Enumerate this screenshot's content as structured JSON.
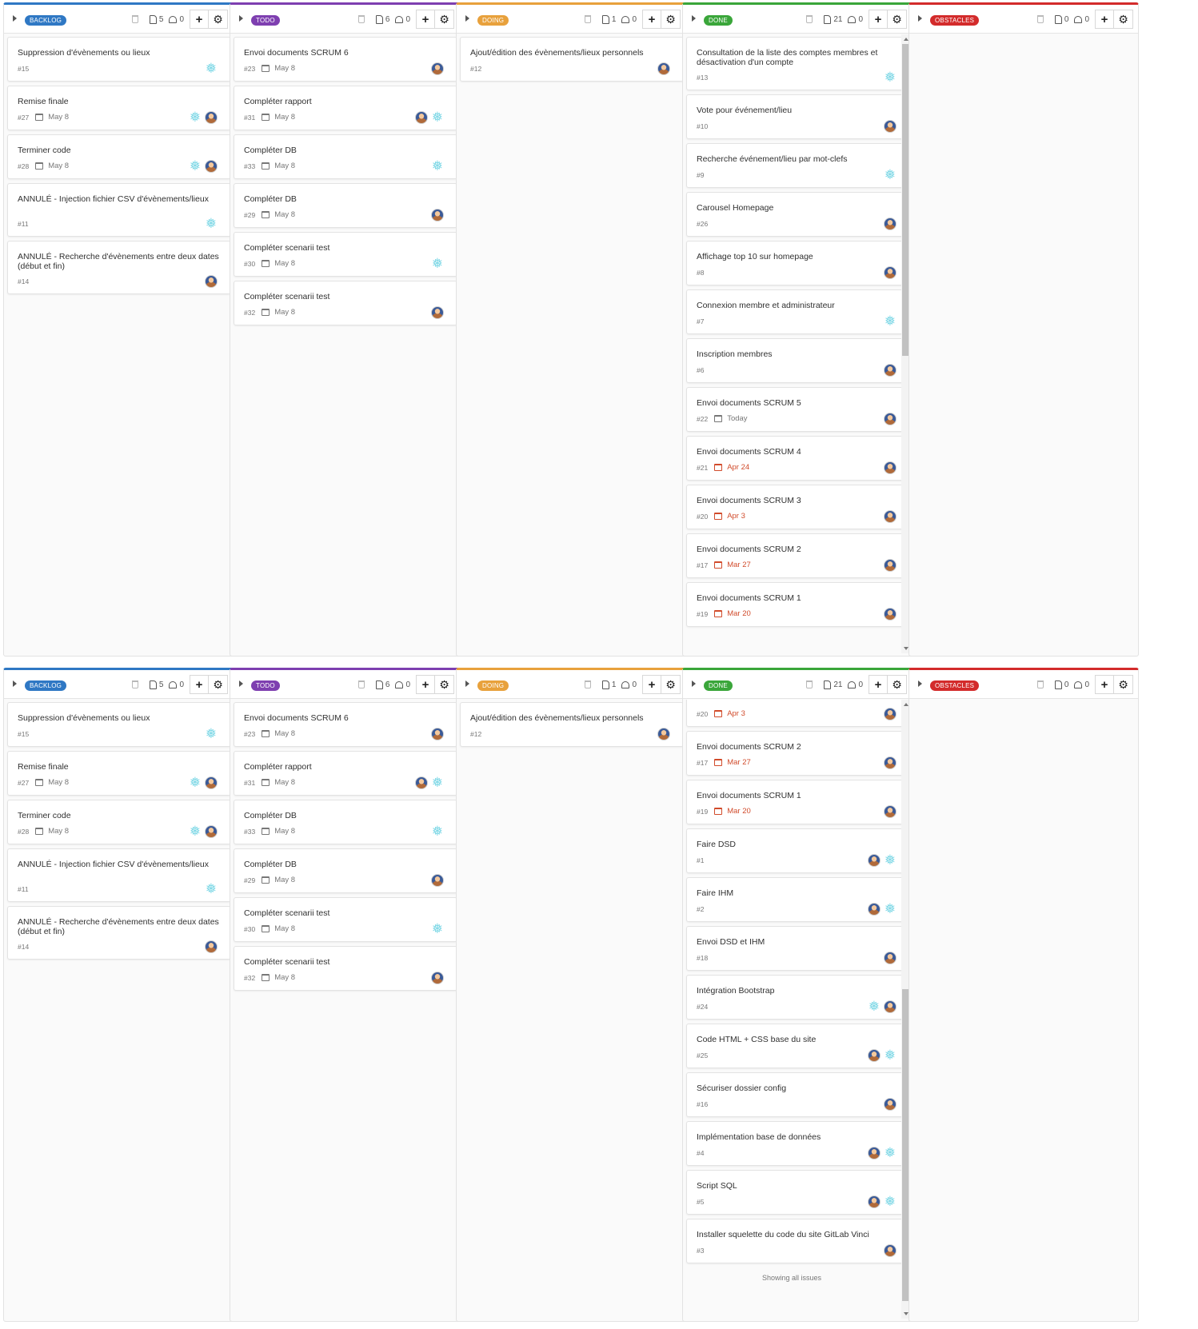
{
  "colors": {
    "backlog": "#2f78c4",
    "todo": "#7e3fb0",
    "doing": "#e8a13c",
    "done": "#3aa63a",
    "obstacles": "#d32b2b",
    "overdue": "#d14b2b"
  },
  "icons": {
    "trash": "trash-icon",
    "issues": "issue-icon",
    "weight": "weight-icon",
    "add": "plus-icon",
    "settings": "gear-icon",
    "calendar": "calendar-icon",
    "collapse": "caret-right-icon",
    "identicon": "snowflake-avatar-icon"
  },
  "columns": {
    "backlog": {
      "label": "BACKLOG",
      "issues": "5",
      "weight": "0",
      "cards": [
        {
          "title": "Suppression d'évènements ou lieux",
          "id": "#15",
          "due": "",
          "assignees": [
            "snow"
          ]
        },
        {
          "title": "Remise finale",
          "id": "#27",
          "due": "May 8",
          "assignees": [
            "snow",
            "avatar"
          ]
        },
        {
          "title": "Terminer code",
          "id": "#28",
          "due": "May 8",
          "assignees": [
            "snow",
            "avatar"
          ]
        },
        {
          "title": "ANNULÉ - Injection fichier CSV d'évènements/lieux",
          "id": "#11",
          "due": "",
          "assignees": [
            "snow"
          ]
        },
        {
          "title": "ANNULÉ - Recherche d'évènements entre deux dates (début et fin)",
          "id": "#14",
          "due": "",
          "assignees": [
            "avatar"
          ]
        }
      ]
    },
    "todo": {
      "label": "TODO",
      "issues": "6",
      "weight": "0",
      "cards": [
        {
          "title": "Envoi documents SCRUM 6",
          "id": "#23",
          "due": "May 8",
          "assignees": [
            "avatar"
          ]
        },
        {
          "title": "Compléter rapport",
          "id": "#31",
          "due": "May 8",
          "assignees": [
            "avatar",
            "snow"
          ]
        },
        {
          "title": "Compléter DB",
          "id": "#33",
          "due": "May 8",
          "assignees": [
            "snow"
          ]
        },
        {
          "title": "Compléter DB",
          "id": "#29",
          "due": "May 8",
          "assignees": [
            "avatar"
          ]
        },
        {
          "title": "Compléter scenarii test",
          "id": "#30",
          "due": "May 8",
          "assignees": [
            "snow"
          ]
        },
        {
          "title": "Compléter scenarii test",
          "id": "#32",
          "due": "May 8",
          "assignees": [
            "avatar"
          ]
        }
      ]
    },
    "doing": {
      "label": "DOING",
      "issues": "1",
      "weight": "0",
      "cards": [
        {
          "title": "Ajout/édition des évènements/lieux personnels",
          "id": "#12",
          "due": "",
          "assignees": [
            "avatar"
          ]
        }
      ]
    },
    "done": {
      "label": "DONE",
      "issues": "21",
      "weight": "0",
      "cards": [
        {
          "title": "Consultation de la liste des comptes membres et désactivation d'un compte",
          "id": "#13",
          "due": "",
          "assignees": [
            "snow"
          ]
        },
        {
          "title": "Vote pour événement/lieu",
          "id": "#10",
          "due": "",
          "assignees": [
            "avatar"
          ]
        },
        {
          "title": "Recherche événement/lieu par mot-clefs",
          "id": "#9",
          "due": "",
          "assignees": [
            "snow"
          ]
        },
        {
          "title": "Carousel Homepage",
          "id": "#26",
          "due": "",
          "assignees": [
            "avatar"
          ]
        },
        {
          "title": "Affichage top 10 sur homepage",
          "id": "#8",
          "due": "",
          "assignees": [
            "avatar"
          ]
        },
        {
          "title": "Connexion membre et administrateur",
          "id": "#7",
          "due": "",
          "assignees": [
            "snow"
          ]
        },
        {
          "title": "Inscription membres",
          "id": "#6",
          "due": "",
          "assignees": [
            "avatar"
          ]
        },
        {
          "title": "Envoi documents SCRUM 5",
          "id": "#22",
          "due": "Today",
          "overdue": false,
          "assignees": [
            "avatar"
          ]
        },
        {
          "title": "Envoi documents SCRUM 4",
          "id": "#21",
          "due": "Apr 24",
          "overdue": true,
          "assignees": [
            "avatar"
          ]
        },
        {
          "title": "Envoi documents SCRUM 3",
          "id": "#20",
          "due": "Apr 3",
          "overdue": true,
          "assignees": [
            "avatar"
          ]
        },
        {
          "title": "Envoi documents SCRUM 2",
          "id": "#17",
          "due": "Mar 27",
          "overdue": true,
          "assignees": [
            "avatar"
          ]
        },
        {
          "title": "Envoi documents SCRUM 1",
          "id": "#19",
          "due": "Mar 20",
          "overdue": true,
          "assignees": [
            "avatar"
          ]
        }
      ],
      "cards_scrolled": [
        {
          "title": "",
          "id": "#20",
          "due": "Apr 3",
          "overdue": true,
          "assignees": [
            "avatar"
          ]
        },
        {
          "title": "Envoi documents SCRUM 2",
          "id": "#17",
          "due": "Mar 27",
          "overdue": true,
          "assignees": [
            "avatar"
          ]
        },
        {
          "title": "Envoi documents SCRUM 1",
          "id": "#19",
          "due": "Mar 20",
          "overdue": true,
          "assignees": [
            "avatar"
          ]
        },
        {
          "title": "Faire DSD",
          "id": "#1",
          "due": "",
          "assignees": [
            "avatar",
            "snow"
          ]
        },
        {
          "title": "Faire IHM",
          "id": "#2",
          "due": "",
          "assignees": [
            "avatar",
            "snow"
          ]
        },
        {
          "title": "Envoi DSD et IHM",
          "id": "#18",
          "due": "",
          "assignees": [
            "avatar"
          ]
        },
        {
          "title": "Intégration Bootstrap",
          "id": "#24",
          "due": "",
          "assignees": [
            "snow",
            "avatar"
          ]
        },
        {
          "title": "Code HTML + CSS base du site",
          "id": "#25",
          "due": "",
          "assignees": [
            "avatar",
            "snow"
          ]
        },
        {
          "title": "Sécuriser dossier config",
          "id": "#16",
          "due": "",
          "assignees": [
            "avatar"
          ]
        },
        {
          "title": "Implémentation base de données",
          "id": "#4",
          "due": "",
          "assignees": [
            "avatar",
            "snow"
          ]
        },
        {
          "title": "Script SQL",
          "id": "#5",
          "due": "",
          "assignees": [
            "avatar",
            "snow"
          ]
        },
        {
          "title": "Installer squelette du code du site GitLab Vinci",
          "id": "#3",
          "due": "",
          "assignees": [
            "avatar"
          ]
        }
      ],
      "footer": "Showing all issues",
      "scroll_top": 0.0,
      "scroll_bottom_view": 0.55
    },
    "obstacles": {
      "label": "OBSTACLES",
      "issues": "0",
      "weight": "0",
      "cards": []
    }
  }
}
